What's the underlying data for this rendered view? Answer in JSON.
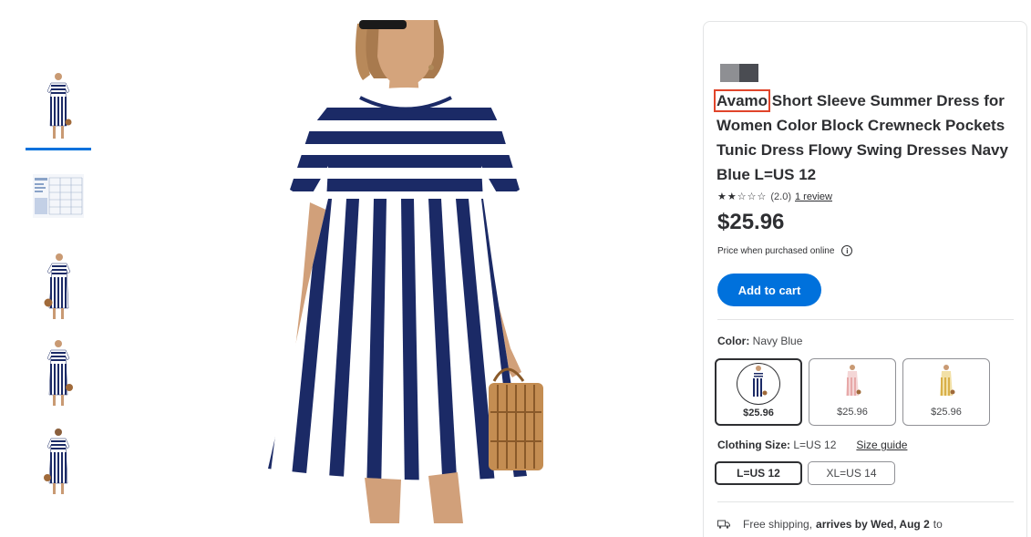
{
  "thumbnails": [
    {
      "name": "thumb-1",
      "kind": "dress-front",
      "active": true
    },
    {
      "name": "thumb-2",
      "kind": "size-chart",
      "active": false
    },
    {
      "name": "thumb-3",
      "kind": "dress-side",
      "active": false
    },
    {
      "name": "thumb-4",
      "kind": "dress-bag",
      "active": false
    },
    {
      "name": "thumb-5",
      "kind": "dress-back",
      "active": false
    }
  ],
  "product": {
    "brand": "Avamo",
    "title_rest": " Short Sleeve Summer Dress for Women Color Block Crewneck Pockets Tunic Dress Flowy Swing Dresses Navy Blue L=US 12",
    "rating_stars": 2,
    "rating_max": 5,
    "rating_value": "(2.0)",
    "review_link": "1 review",
    "price": "$25.96",
    "price_note": "Price when purchased online",
    "info_icon": "i",
    "add_to_cart": "Add to cart"
  },
  "color": {
    "label": "Color:",
    "selected": "Navy Blue",
    "options": [
      {
        "name": "Navy Blue",
        "price": "$25.96",
        "tone": "#1f2f6b"
      },
      {
        "name": "Pink",
        "price": "$25.96",
        "tone": "#e7a9a9"
      },
      {
        "name": "Yellow",
        "price": "$25.96",
        "tone": "#d9b04a"
      }
    ]
  },
  "size": {
    "label": "Clothing Size:",
    "selected": "L=US 12",
    "guide": "Size guide",
    "options": [
      "L=US 12",
      "XL=US 14"
    ]
  },
  "shipping": {
    "prefix": "Free shipping,",
    "bold": "arrives by Wed, Aug 2",
    "suffix": "to"
  },
  "colors": {
    "accent": "#0071dc",
    "navy": "#1b2a66",
    "highlight": "#e0452b"
  }
}
